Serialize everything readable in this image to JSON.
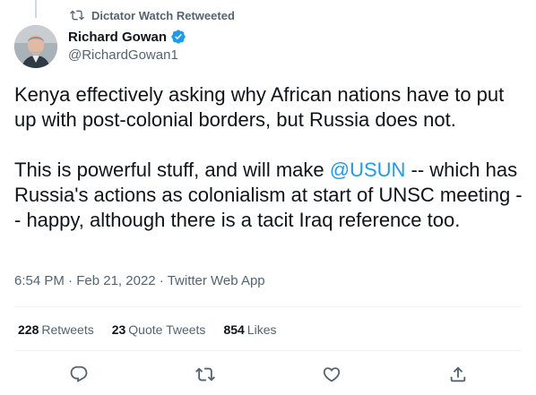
{
  "retweet_context": {
    "text": "Dictator Watch Retweeted",
    "icon": "retweet-icon"
  },
  "author": {
    "display_name": "Richard Gowan",
    "handle": "@RichardGowan1",
    "verified": true,
    "verified_color": "#1d9bf0"
  },
  "tweet": {
    "paragraph1": "Kenya effectively asking why African nations have to put up with post-colonial borders, but Russia does not.",
    "p2_before": "This is powerful stuff, and will make ",
    "p2_mention": "@USUN",
    "p2_after": " -- which has Russia's actions as colonialism at start of UNSC meeting -- happy, although there is a tacit Iraq reference too."
  },
  "meta": {
    "time": "6:54 PM",
    "separator": "·",
    "date": "Feb 21, 2022",
    "source": "Twitter Web App"
  },
  "stats": {
    "retweets_count": "228",
    "retweets_label": "Retweets",
    "quotes_count": "23",
    "quotes_label": "Quote Tweets",
    "likes_count": "854",
    "likes_label": "Likes"
  },
  "actions": [
    "reply-icon",
    "retweet-icon",
    "like-icon",
    "share-icon"
  ],
  "colors": {
    "text": "#0f1419",
    "secondary": "#536471",
    "link": "#1d9bf0",
    "divider": "#eff3f4"
  }
}
